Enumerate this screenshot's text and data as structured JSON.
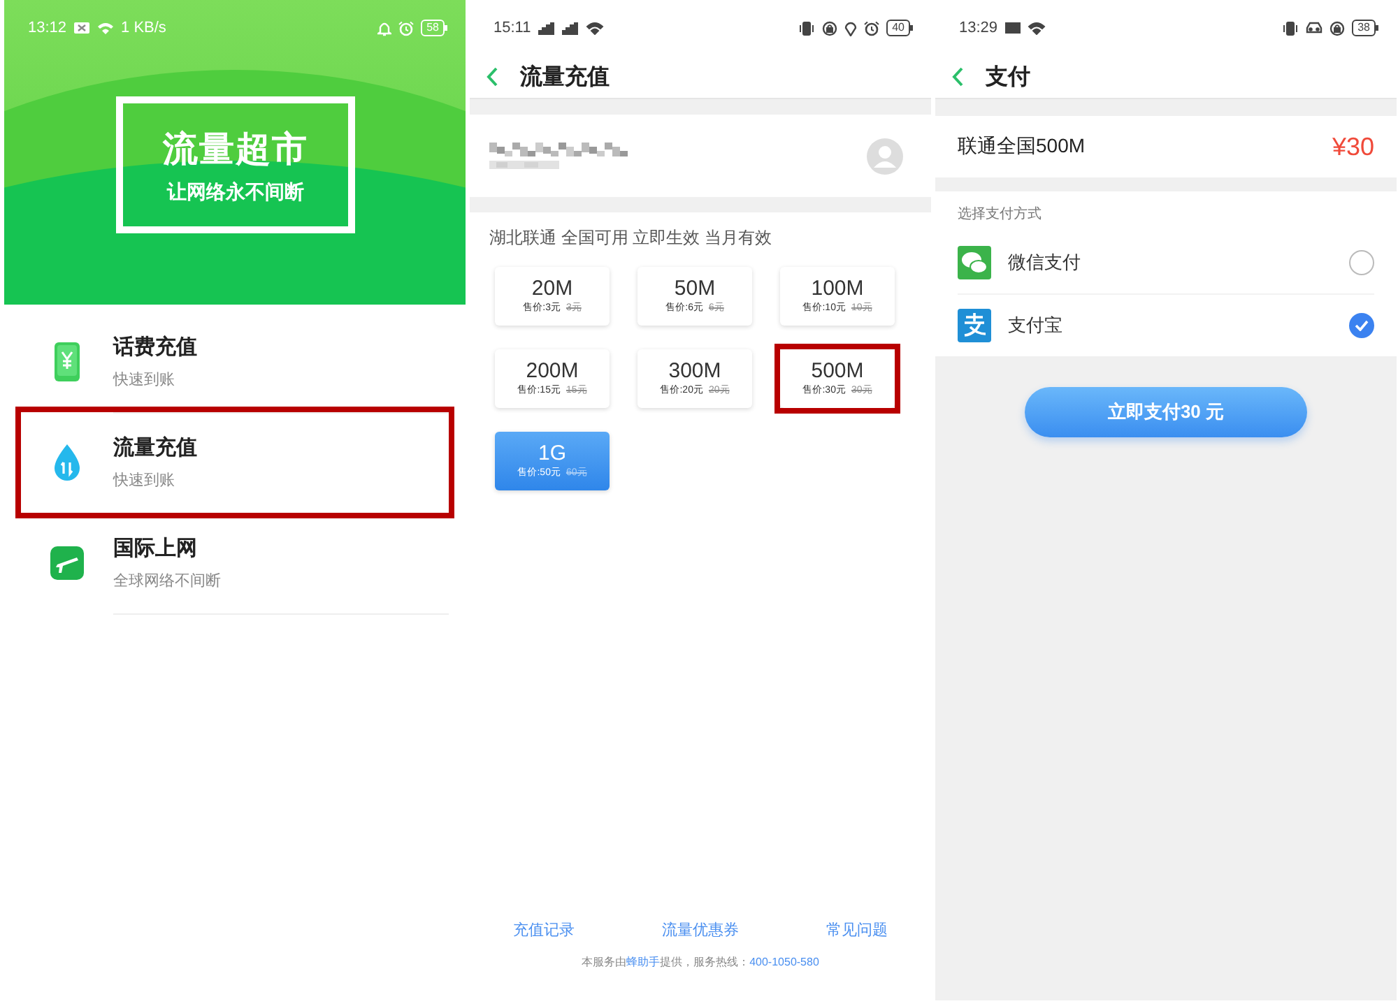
{
  "screens": [
    {
      "kind": "home",
      "status_bar": {
        "time": "13:12",
        "speed": "1 KB/s",
        "battery": "58"
      },
      "banner": {
        "title": "流量超市",
        "subtitle": "让网络永不间断"
      },
      "menu": [
        {
          "title": "话费充值",
          "subtitle": "快速到账",
          "highlighted": false
        },
        {
          "title": "流量充值",
          "subtitle": "快速到账",
          "highlighted": true
        },
        {
          "title": "国际上网",
          "subtitle": "全球网络不间断",
          "highlighted": false
        }
      ]
    },
    {
      "kind": "recharge",
      "status_bar": {
        "time": "15:11",
        "battery": "40"
      },
      "title": "流量充值",
      "carrier_info": "湖北联通 全国可用 立即生效 当月有效",
      "packages": [
        {
          "size": "20M",
          "price": "售价:3元",
          "original_price": "3元",
          "selected": false,
          "highlighted": false
        },
        {
          "size": "50M",
          "price": "售价:6元",
          "original_price": "6元",
          "selected": false,
          "highlighted": false
        },
        {
          "size": "100M",
          "price": "售价:10元",
          "original_price": "10元",
          "selected": false,
          "highlighted": false
        },
        {
          "size": "200M",
          "price": "售价:15元",
          "original_price": "15元",
          "selected": false,
          "highlighted": false
        },
        {
          "size": "300M",
          "price": "售价:20元",
          "original_price": "20元",
          "selected": false,
          "highlighted": false
        },
        {
          "size": "500M",
          "price": "售价:30元",
          "original_price": "30元",
          "selected": false,
          "highlighted": true
        },
        {
          "size": "1G",
          "price": "售价:50元",
          "original_price": "60元",
          "selected": true,
          "highlighted": false
        }
      ],
      "links": [
        "充值记录",
        "流量优惠券",
        "常见问题"
      ],
      "footer": {
        "text_1": "本服务由",
        "provider": "蜂助手",
        "text_2": "提供，服务热线：",
        "hotline": "400-1050-580"
      }
    },
    {
      "kind": "payment",
      "status_bar": {
        "time": "13:29",
        "battery": "38"
      },
      "title": "支付",
      "product": {
        "name": "联通全国500M",
        "price": "¥30"
      },
      "section_label": "选择支付方式",
      "methods": [
        {
          "name": "微信支付",
          "selected": false
        },
        {
          "name": "支付宝",
          "selected": true
        }
      ],
      "pay_button": "立即支付30 元"
    }
  ]
}
